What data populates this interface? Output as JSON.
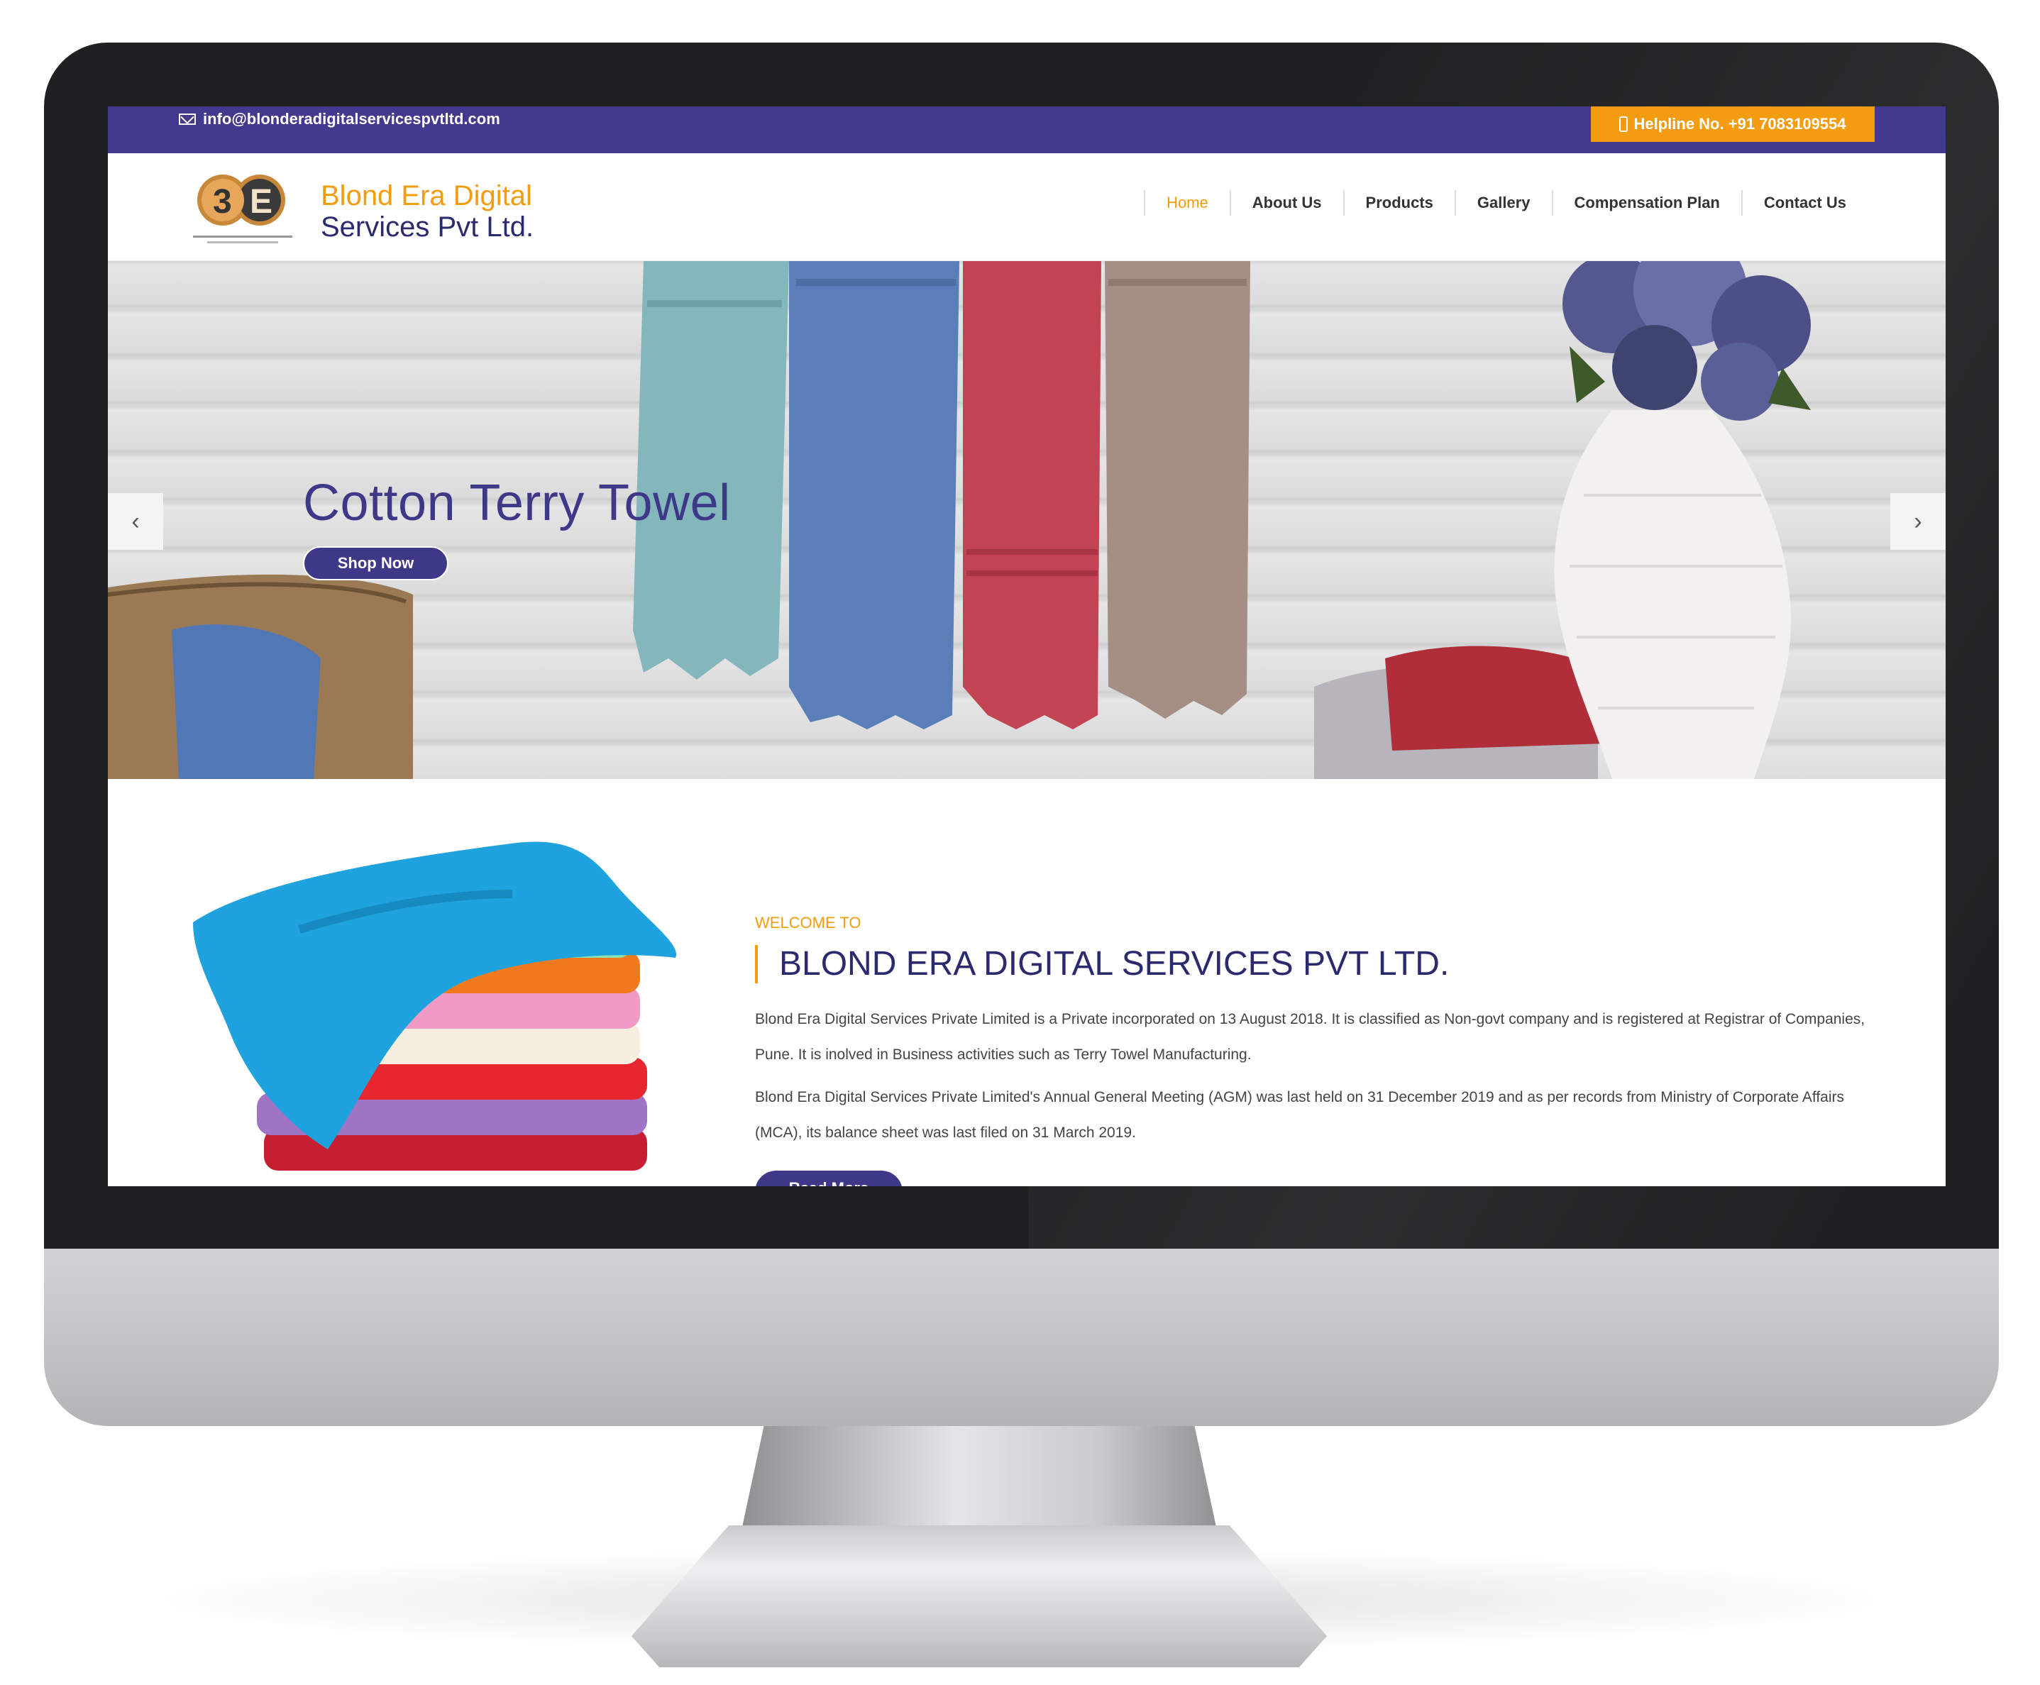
{
  "topbar": {
    "email": "info@blonderadigitalservicespvtltd.com",
    "helpline": "Helpline No. +91 7083109554"
  },
  "brand": {
    "line1": "Blond Era Digital",
    "line2": "Services Pvt Ltd."
  },
  "nav": {
    "items": [
      {
        "label": "Home",
        "active": true
      },
      {
        "label": "About Us"
      },
      {
        "label": "Products"
      },
      {
        "label": "Gallery"
      },
      {
        "label": "Compensation Plan"
      },
      {
        "label": "Contact Us"
      }
    ]
  },
  "hero": {
    "title": "Cotton Terry Towel",
    "button": "Shop Now",
    "prev": "‹",
    "next": "›"
  },
  "welcome": {
    "label": "WELCOME TO",
    "title": "BLOND ERA DIGITAL SERVICES PVT LTD.",
    "paragraphs": [
      "Blond Era Digital Services Private Limited is a Private incorporated on 13 August 2018. It is classified as Non-govt company and is registered at Registrar of Companies, Pune. It is inolved in Business activities such as Terry Towel Manufacturing.",
      "Blond Era Digital Services Private Limited's Annual General Meeting (AGM) was last held on 31 December 2019 and as per records from Ministry of Corporate Affairs (MCA), its balance sheet was last filed on 31 March 2019."
    ],
    "button": "Read More"
  },
  "colors": {
    "primary": "#3e3888",
    "accent": "#f39c12",
    "topbar": "#423a8e"
  }
}
